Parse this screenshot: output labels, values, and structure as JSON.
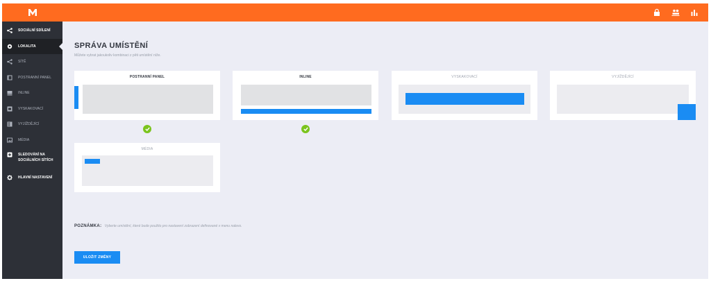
{
  "colors": {
    "accent": "#ff6b1f",
    "primary": "#1a8cf3",
    "success": "#7bc41e",
    "sidebar": "#2d3037"
  },
  "header": {
    "icons": [
      "lock-icon",
      "users-icon",
      "bar-chart-icon"
    ]
  },
  "sidebar": {
    "items": [
      {
        "label": "Sociální sdílení",
        "icon": "share-icon"
      },
      {
        "label": "Lokalita",
        "icon": "location-pin-icon"
      },
      {
        "label": "Sítě",
        "icon": "share-icon"
      },
      {
        "label": "Postranní panel",
        "icon": "sidebar-layout-icon"
      },
      {
        "label": "Inline",
        "icon": "inline-layout-icon"
      },
      {
        "label": "Vyskakovací",
        "icon": "popup-layout-icon"
      },
      {
        "label": "Vyjíždějící",
        "icon": "flyin-layout-icon"
      },
      {
        "label": "Média",
        "icon": "image-icon"
      },
      {
        "label": "Sledování na sociálních sítích",
        "icon": "follow-icon"
      },
      {
        "label": "Hlavní nastavení",
        "icon": "gear-icon"
      }
    ]
  },
  "main": {
    "title": "SPRÁVA UMÍSTĚNÍ",
    "subtitle": "Můžete vybrat jakoukoliv kombinaci z pěti umístění níže.",
    "cards": [
      {
        "label": "Postranní panel",
        "selected": true
      },
      {
        "label": "Inline",
        "selected": true
      },
      {
        "label": "Vyskakovací",
        "selected": false
      },
      {
        "label": "Vyjíždějící",
        "selected": false
      },
      {
        "label": "Média",
        "selected": false
      }
    ],
    "note_label": "POZNÁMKA:",
    "note_text": "Vyberte umístění, které bude použito pro nastavení zobrazení definované v menu nalevo.",
    "save_label": "ULOŽIT ZMĚNY"
  }
}
